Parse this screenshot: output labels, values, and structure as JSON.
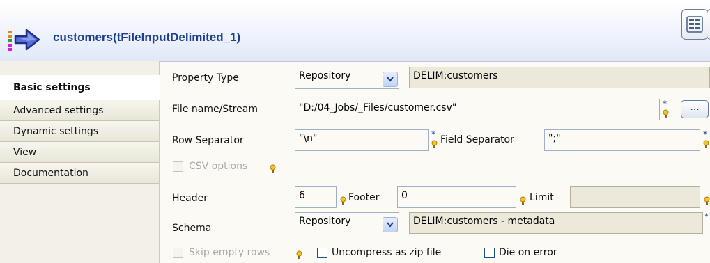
{
  "header": {
    "title": "customers(tFileInputDelimited_1)",
    "icon": "file-input-delimited-icon",
    "accent_color": "#1f3f8c"
  },
  "sidebar": {
    "items": [
      {
        "label": "Basic settings",
        "selected": true
      },
      {
        "label": "Advanced settings",
        "selected": false
      },
      {
        "label": "Dynamic settings",
        "selected": false
      },
      {
        "label": "View",
        "selected": false
      },
      {
        "label": "Documentation",
        "selected": false
      }
    ]
  },
  "form": {
    "property_type": {
      "label": "Property Type",
      "value": "Repository",
      "repository": "DELIM:customers"
    },
    "file_name": {
      "label": "File name/Stream",
      "value": "\"D:/04_Jobs/_Files/customer.csv\"",
      "browse_label": "..."
    },
    "row_separator": {
      "label": "Row Separator",
      "value": "\"\\n\""
    },
    "field_separator": {
      "label": "Field Separator",
      "value": "\";\""
    },
    "csv_options": {
      "label": "CSV options",
      "checked": false,
      "enabled": false
    },
    "header": {
      "label": "Header",
      "value": "6"
    },
    "footer": {
      "label": "Footer",
      "value": "0"
    },
    "limit": {
      "label": "Limit",
      "value": ""
    },
    "schema": {
      "label": "Schema",
      "value": "Repository",
      "repository": "DELIM:customers - metadata"
    },
    "skip_empty_rows": {
      "label": "Skip empty rows",
      "checked": false,
      "enabled": false
    },
    "uncompress_zip": {
      "label": "Uncompress as zip file",
      "checked": false
    },
    "die_on_error": {
      "label": "Die on error",
      "checked": false
    },
    "required_mark": "*"
  }
}
